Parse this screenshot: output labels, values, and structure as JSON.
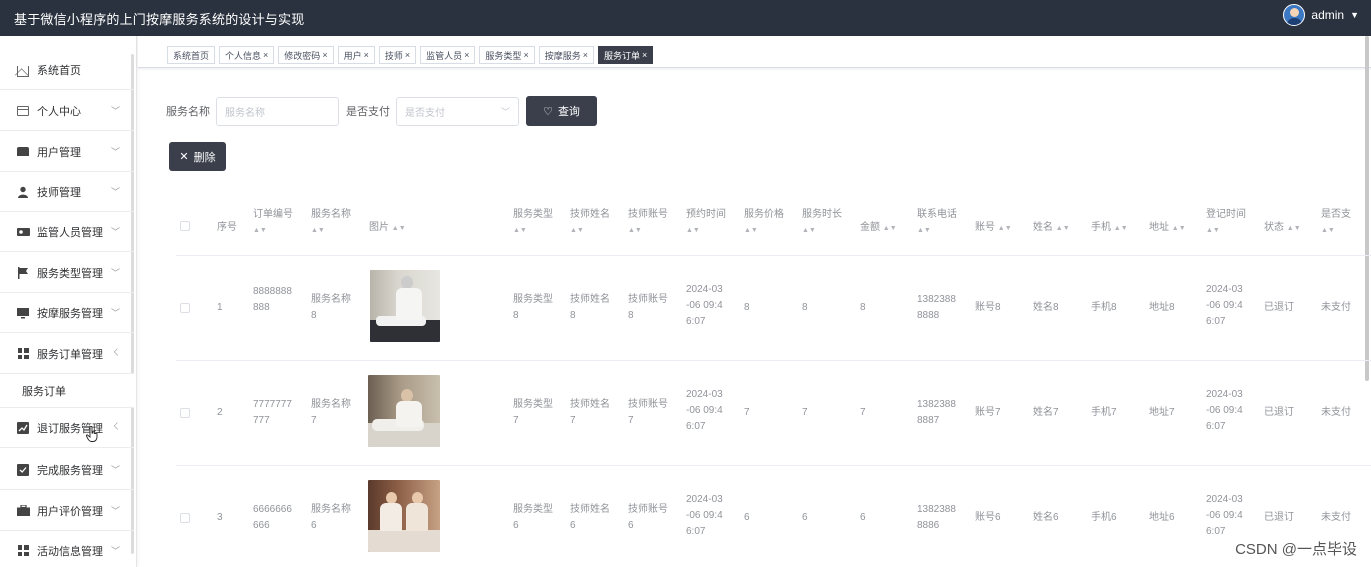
{
  "header": {
    "title": "基于微信小程序的上门按摩服务系统的设计与实现",
    "username": "admin"
  },
  "sidebar": {
    "items": [
      {
        "label": "系统首页",
        "icon": "home-icon"
      },
      {
        "label": "个人中心",
        "icon": "id-card-icon"
      },
      {
        "label": "用户管理",
        "icon": "user-group-icon"
      },
      {
        "label": "技师管理",
        "icon": "person-icon"
      },
      {
        "label": "监管人员管理",
        "icon": "supervisor-icon"
      },
      {
        "label": "服务类型管理",
        "icon": "flag-icon"
      },
      {
        "label": "按摩服务管理",
        "icon": "monitor-icon"
      },
      {
        "label": "服务订单管理",
        "icon": "grid-icon"
      },
      {
        "label": "退订服务管理",
        "icon": "chart-icon"
      },
      {
        "label": "完成服务管理",
        "icon": "clipboard-check-icon"
      },
      {
        "label": "用户评价管理",
        "icon": "briefcase-icon"
      },
      {
        "label": "活动信息管理",
        "icon": "grid-icon"
      }
    ],
    "submenu": {
      "label": "服务订单"
    }
  },
  "tabs": [
    {
      "label": "系统首页",
      "closable": false
    },
    {
      "label": "个人信息",
      "closable": true
    },
    {
      "label": "修改密码",
      "closable": true
    },
    {
      "label": "用户",
      "closable": true
    },
    {
      "label": "技师",
      "closable": true
    },
    {
      "label": "监管人员",
      "closable": true
    },
    {
      "label": "服务类型",
      "closable": true
    },
    {
      "label": "按摩服务",
      "closable": true
    },
    {
      "label": "服务订单",
      "closable": true,
      "active": true
    }
  ],
  "search": {
    "service_name_label": "服务名称",
    "service_name_placeholder": "服务名称",
    "paid_label": "是否支付",
    "paid_placeholder": "是否支付",
    "query_button": "查询"
  },
  "actions": {
    "delete_button": "删除"
  },
  "table": {
    "columns": [
      "序号",
      "订单编号",
      "服务名称",
      "图片",
      "服务类型",
      "技师姓名",
      "技师账号",
      "预约时间",
      "服务价格",
      "服务时长",
      "金额",
      "联系电话",
      "账号",
      "姓名",
      "手机",
      "地址",
      "登记时间",
      "状态",
      "是否支"
    ],
    "rows": [
      {
        "index": "1",
        "order_no_1": "8888888",
        "order_no_2": "888",
        "service_1": "服务名称",
        "service_2": "8",
        "type_1": "服务类型",
        "type_2": "8",
        "tech_name_1": "技师姓名",
        "tech_name_2": "8",
        "tech_acc_1": "技师账号",
        "tech_acc_2": "8",
        "appt_1": "2024-03",
        "appt_2": "-06 09:4",
        "appt_3": "6:07",
        "price": "8",
        "duration": "8",
        "amount": "8",
        "phone_1": "1382388",
        "phone_2": "8888",
        "account": "账号8",
        "name": "姓名8",
        "mobile": "手机8",
        "address": "地址8",
        "reg_1": "2024-03",
        "reg_2": "-06 09:4",
        "reg_3": "6:07",
        "status": "已退订",
        "paid": "未支付"
      },
      {
        "index": "2",
        "order_no_1": "7777777",
        "order_no_2": "777",
        "service_1": "服务名称",
        "service_2": "7",
        "type_1": "服务类型",
        "type_2": "7",
        "tech_name_1": "技师姓名",
        "tech_name_2": "7",
        "tech_acc_1": "技师账号",
        "tech_acc_2": "7",
        "appt_1": "2024-03",
        "appt_2": "-06 09:4",
        "appt_3": "6:07",
        "price": "7",
        "duration": "7",
        "amount": "7",
        "phone_1": "1382388",
        "phone_2": "8887",
        "account": "账号7",
        "name": "姓名7",
        "mobile": "手机7",
        "address": "地址7",
        "reg_1": "2024-03",
        "reg_2": "-06 09:4",
        "reg_3": "6:07",
        "status": "已退订",
        "paid": "未支付"
      },
      {
        "index": "3",
        "order_no_1": "6666666",
        "order_no_2": "666",
        "service_1": "服务名称",
        "service_2": "6",
        "type_1": "服务类型",
        "type_2": "6",
        "tech_name_1": "技师姓名",
        "tech_name_2": "6",
        "tech_acc_1": "技师账号",
        "tech_acc_2": "6",
        "appt_1": "2024-03",
        "appt_2": "-06 09:4",
        "appt_3": "6:07",
        "price": "6",
        "duration": "6",
        "amount": "6",
        "phone_1": "1382388",
        "phone_2": "8886",
        "account": "账号6",
        "name": "姓名6",
        "mobile": "手机6",
        "address": "地址6",
        "reg_1": "2024-03",
        "reg_2": "-06 09:4",
        "reg_3": "6:07",
        "status": "已退订",
        "paid": "未支付"
      }
    ]
  },
  "watermark": "CSDN @一点毕设",
  "colors": {
    "header_bg": "#2b323f",
    "accent_dark": "#3a3f4b"
  }
}
